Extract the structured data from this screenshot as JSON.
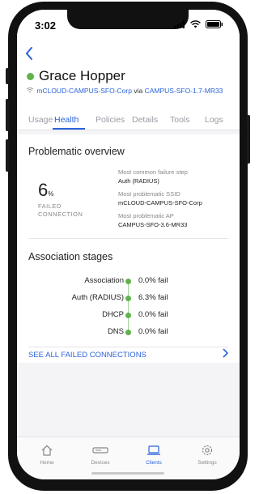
{
  "status_bar": {
    "time": "3:02"
  },
  "client": {
    "name": "Grace Hopper",
    "ssid": "mCLOUD-CAMPUS-SFO-Corp",
    "via": "via",
    "ap": "CAMPUS-SFO-1.7-MR33",
    "status_color": "#5fb34a"
  },
  "tabs": [
    {
      "label": "Usage",
      "active": false
    },
    {
      "label": "Health",
      "active": true
    },
    {
      "label": "Policies",
      "active": false
    },
    {
      "label": "Details",
      "active": false
    },
    {
      "label": "Tools",
      "active": false
    },
    {
      "label": "Logs",
      "active": false
    }
  ],
  "problematic": {
    "title": "Problematic overview",
    "failed_value": "6",
    "failed_unit": "%",
    "failed_label_1": "FAILED",
    "failed_label_2": "CONNECTION",
    "items": [
      {
        "label": "Most common failure step",
        "value": "Auth (RADIUS)"
      },
      {
        "label": "Most problematic SSID",
        "value": "mCLOUD-CAMPUS-SFO-Corp"
      },
      {
        "label": "Most problematic AP",
        "value": "CAMPUS-SFO-3.6-MR33"
      }
    ]
  },
  "association": {
    "title": "Association stages",
    "stages": [
      {
        "name": "Association",
        "value": "0.0% fail"
      },
      {
        "name": "Auth (RADIUS)",
        "value": "6.3% fail"
      },
      {
        "name": "DHCP",
        "value": "0.0% fail"
      },
      {
        "name": "DNS",
        "value": "0.0% fail"
      }
    ],
    "see_all": "SEE ALL FAILED CONNECTIONS"
  },
  "tabbar": [
    {
      "label": "Home",
      "icon": "home-icon",
      "active": false
    },
    {
      "label": "Devices",
      "icon": "device-icon",
      "active": false
    },
    {
      "label": "Clients",
      "icon": "laptop-icon",
      "active": true
    },
    {
      "label": "Settings",
      "icon": "gear-icon",
      "active": false
    }
  ],
  "colors": {
    "accent": "#2b63d9",
    "success": "#5fb34a"
  }
}
